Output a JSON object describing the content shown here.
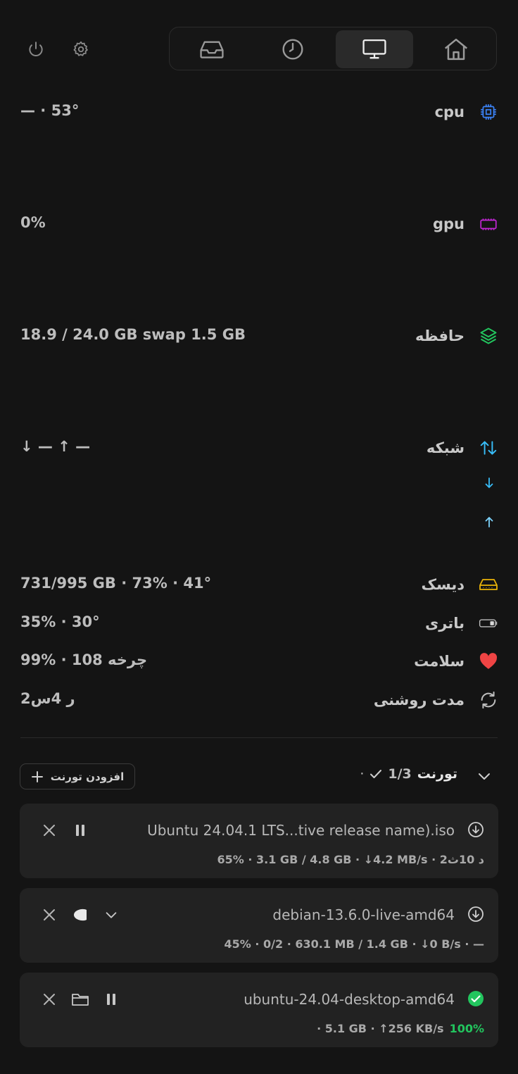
{
  "colors": {
    "cpu_icon": "#3b82f6",
    "gpu_icon": "#c026d3",
    "memory_icon": "#22c55e",
    "network_icon": "#38bdf8",
    "disk_icon": "#eab308",
    "health_icon": "#ef4444",
    "success": "#22c55e"
  },
  "topbar": {
    "left_icons": [
      "power-icon",
      "gear-icon"
    ],
    "tabs": [
      {
        "icon": "inbox-icon",
        "active": false
      },
      {
        "icon": "clock-icon",
        "active": false
      },
      {
        "icon": "monitor-icon",
        "active": true
      },
      {
        "icon": "home-icon",
        "active": false
      }
    ]
  },
  "stats": {
    "cpu": {
      "label": "cpu",
      "value": "— · 53°",
      "icon": "cpu-chip-icon"
    },
    "gpu": {
      "label": "gpu",
      "value": "0%",
      "icon": "gpu-icon"
    },
    "memory": {
      "label": "حافظه",
      "value": "18.9 / 24.0 GB  swap 1.5 GB",
      "icon": "layers-icon"
    },
    "network": {
      "label": "شبکه",
      "value": "↓ —   ↑ —",
      "icon": "arrows-up-down-icon"
    },
    "disk": {
      "label": "دیسک",
      "value": "731/995 GB · 73% · 41°",
      "icon": "hard-drive-icon"
    },
    "battery": {
      "label": "باتری",
      "value": "35% · 30°",
      "icon": "battery-icon"
    },
    "health": {
      "label": "سلامت",
      "value": "99% · 108 چرخه",
      "icon": "heart-icon"
    },
    "uptime": {
      "label": "مدت روشنی",
      "value": "2ر 4س",
      "icon": "refresh-icon"
    }
  },
  "torrents": {
    "title": "تورنت",
    "count": "1/3",
    "dot": "·",
    "add_label": "افزودن تورنت",
    "items": [
      {
        "name": "Ubuntu 24.04.1 LTS...tive release name).iso",
        "detail": "65% · 3.1 GB / 4.8 GB · ↓4.2 MB/s · د 10ث2",
        "state": "downloading",
        "progress": 0.65
      },
      {
        "name": "debian-13.6.0-live-amd64",
        "detail": "45% · 0/2 · 630.1 MB / 1.4 GB · ↓0 B/s · —",
        "state": "downloading",
        "progress": 0.45
      },
      {
        "name": "ubuntu-24.04-desktop-amd64",
        "detail": "· 5.1 GB · ↑256 KB/s",
        "percent": "100%",
        "state": "complete",
        "progress": 1.0
      }
    ]
  }
}
